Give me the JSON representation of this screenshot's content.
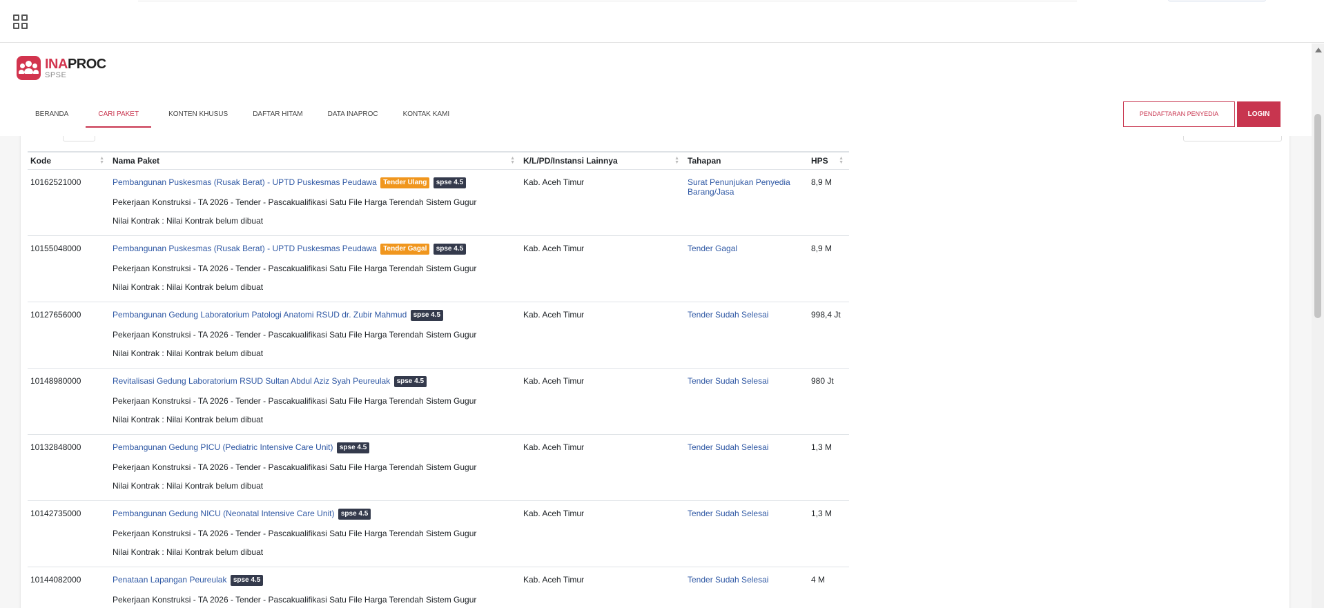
{
  "nav": {
    "items": [
      {
        "label": "BERANDA"
      },
      {
        "label": "CARI PAKET"
      },
      {
        "label": "KONTEN KHUSUS"
      },
      {
        "label": "DAFTAR HITAM"
      },
      {
        "label": "DATA INAPROC"
      },
      {
        "label": "KONTAK KAMI"
      }
    ],
    "active_index": 1
  },
  "logo": {
    "brand_prefix": "INA",
    "brand_suffix": "PROC",
    "sub": "SPSE"
  },
  "buttons": {
    "register": "PENDAFTARAN PENYEDIA",
    "login": "LOGIN"
  },
  "colors": {
    "accent": "#c8354f",
    "link": "#2f58a4",
    "badge_warning": "#f0961e",
    "badge_dark": "#343a4c"
  },
  "table": {
    "headers": [
      "Kode",
      "Nama Paket",
      "K/L/PD/Instansi Lainnya",
      "Tahapan",
      "HPS"
    ],
    "rows": [
      {
        "kode": "10162521000",
        "nama": "Pembangunan Puskesmas (Rusak Berat) - UPTD Puskesmas Peudawa",
        "status_badge": "Tender Ulang",
        "version_badge": "spse 4.5",
        "detail": "Pekerjaan Konstruksi - TA 2026 - Tender - Pascakualifikasi Satu File Harga Terendah Sistem Gugur",
        "kontrak": "Nilai Kontrak : Nilai Kontrak belum dibuat",
        "instansi": "Kab. Aceh Timur",
        "tahapan": "Surat Penunjukan Penyedia Barang/Jasa",
        "hps": "8,9 M"
      },
      {
        "kode": "10155048000",
        "nama": "Pembangunan Puskesmas (Rusak Berat) - UPTD Puskesmas Peudawa",
        "status_badge": "Tender Gagal",
        "version_badge": "spse 4.5",
        "detail": "Pekerjaan Konstruksi - TA 2026 - Tender - Pascakualifikasi Satu File Harga Terendah Sistem Gugur",
        "kontrak": "Nilai Kontrak : Nilai Kontrak belum dibuat",
        "instansi": "Kab. Aceh Timur",
        "tahapan": "Tender Gagal",
        "hps": "8,9 M"
      },
      {
        "kode": "10127656000",
        "nama": "Pembangunan Gedung Laboratorium Patologi Anatomi RSUD dr. Zubir Mahmud",
        "status_badge": "",
        "version_badge": "spse 4.5",
        "detail": "Pekerjaan Konstruksi - TA 2026 - Tender - Pascakualifikasi Satu File Harga Terendah Sistem Gugur",
        "kontrak": "Nilai Kontrak : Nilai Kontrak belum dibuat",
        "instansi": "Kab. Aceh Timur",
        "tahapan": "Tender Sudah Selesai",
        "hps": "998,4 Jt"
      },
      {
        "kode": "10148980000",
        "nama": "Revitalisasi Gedung Laboratorium RSUD Sultan Abdul Aziz Syah Peureulak",
        "status_badge": "",
        "version_badge": "spse 4.5",
        "detail": "Pekerjaan Konstruksi - TA 2026 - Tender - Pascakualifikasi Satu File Harga Terendah Sistem Gugur",
        "kontrak": "Nilai Kontrak : Nilai Kontrak belum dibuat",
        "instansi": "Kab. Aceh Timur",
        "tahapan": "Tender Sudah Selesai",
        "hps": "980 Jt"
      },
      {
        "kode": "10132848000",
        "nama": "Pembangunan Gedung PICU (Pediatric Intensive Care Unit)",
        "status_badge": "",
        "version_badge": "spse 4.5",
        "detail": "Pekerjaan Konstruksi - TA 2026 - Tender - Pascakualifikasi Satu File Harga Terendah Sistem Gugur",
        "kontrak": "Nilai Kontrak : Nilai Kontrak belum dibuat",
        "instansi": "Kab. Aceh Timur",
        "tahapan": "Tender Sudah Selesai",
        "hps": "1,3 M"
      },
      {
        "kode": "10142735000",
        "nama": "Pembangunan Gedung NICU (Neonatal Intensive Care Unit)",
        "status_badge": "",
        "version_badge": "spse 4.5",
        "detail": "Pekerjaan Konstruksi - TA 2026 - Tender - Pascakualifikasi Satu File Harga Terendah Sistem Gugur",
        "kontrak": "Nilai Kontrak : Nilai Kontrak belum dibuat",
        "instansi": "Kab. Aceh Timur",
        "tahapan": "Tender Sudah Selesai",
        "hps": "1,3 M"
      },
      {
        "kode": "10144082000",
        "nama": "Penataan Lapangan Peureulak",
        "status_badge": "",
        "version_badge": "spse 4.5",
        "detail": "Pekerjaan Konstruksi - TA 2026 - Tender - Pascakualifikasi Satu File Harga Terendah Sistem Gugur",
        "kontrak": "",
        "instansi": "Kab. Aceh Timur",
        "tahapan": "Tender Sudah Selesai",
        "hps": "4 M"
      }
    ]
  }
}
